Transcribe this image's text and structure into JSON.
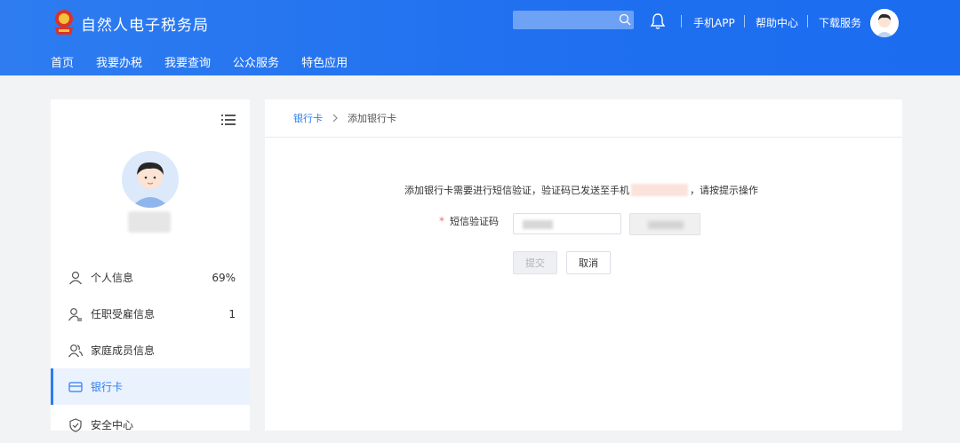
{
  "header": {
    "title": "自然人电子税务局",
    "search_placeholder": "",
    "links": [
      "手机APP",
      "帮助中心",
      "下载服务"
    ]
  },
  "nav": [
    "首页",
    "我要办税",
    "我要查询",
    "公众服务",
    "特色应用"
  ],
  "sidebar": {
    "items": [
      {
        "label": "个人信息",
        "value": "69%",
        "icon": "user-icon"
      },
      {
        "label": "任职受雇信息",
        "value": "1",
        "icon": "user-list-icon"
      },
      {
        "label": "家庭成员信息",
        "value": "",
        "icon": "family-icon"
      },
      {
        "label": "银行卡",
        "value": "",
        "icon": "bank-card-icon",
        "active": true
      },
      {
        "label": "安全中心",
        "value": "",
        "icon": "shield-icon"
      }
    ]
  },
  "breadcrumb": {
    "parent": "银行卡",
    "current": "添加银行卡"
  },
  "form": {
    "notice_prefix": "添加银行卡需要进行短信验证，验证码已发送至手机",
    "notice_suffix": "，请按提示操作",
    "required_mark": "*",
    "code_label": "短信验证码",
    "submit_label": "提交",
    "cancel_label": "取消"
  },
  "colors": {
    "brand_blue": "#1f6ff0",
    "active_blue": "#2d7bf0",
    "required_red": "#f56c6c"
  }
}
